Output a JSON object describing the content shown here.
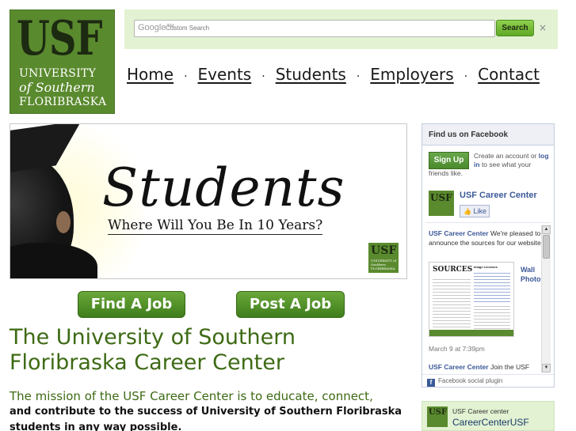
{
  "logo": {
    "abbr": "USF",
    "line1": "UNIVERSITY",
    "line2": "of Southern",
    "line3": "FLORIBRASKA"
  },
  "search": {
    "provider": "Google™",
    "placeholder": "Custom Search",
    "button_label": "Search",
    "clear_label": "×"
  },
  "nav": {
    "items": [
      "Home",
      "Events",
      "Students",
      "Employers",
      "Contact"
    ],
    "separator": "·"
  },
  "banner": {
    "title": "Students",
    "subtitle": "Where Will You Be In 10 Years?",
    "logo_abbr": "USF",
    "logo_text": "UNIVERSITY of Southern FLORIBRASKA"
  },
  "actions": {
    "find_job": "Find A Job",
    "post_job": "Post A Job"
  },
  "main": {
    "heading": "The University of Southern Floribraska Career Center",
    "mission_line1": "The mission of the USF Career Center is to educate, connect,",
    "mission_line2": "and contribute to the success of University of Southern Floribraska students in any way possible."
  },
  "facebook": {
    "header": "Find us on Facebook",
    "signup_label": "Sign Up",
    "create_text": "Create an account or",
    "login_label": "log in",
    "create_rest": "to see what your",
    "friends_text": "friends like.",
    "page_logo": "USF",
    "page_name": "USF Career Center",
    "like_label": "Like",
    "post1_author": "USF Career Center",
    "post1_text": "We're pleased to announce the sources for our website!",
    "post_image_title": "SOURCES",
    "post_image_subtitle": "Image Licenses",
    "wall_label": "Wall Photo",
    "post1_date": "March 9 at 7:39pm",
    "post2_author": "USF Career Center",
    "post2_text": "Join the USF",
    "footer": "Facebook social plugin"
  },
  "twitter": {
    "logo": "USF",
    "label": "USF Career center",
    "handle": "CareerCenterUSF"
  },
  "colors": {
    "brand_green": "#5a8a2e",
    "heading_green": "#3d6a14",
    "search_bg": "#e2f2d2",
    "facebook_blue": "#3b5998"
  }
}
